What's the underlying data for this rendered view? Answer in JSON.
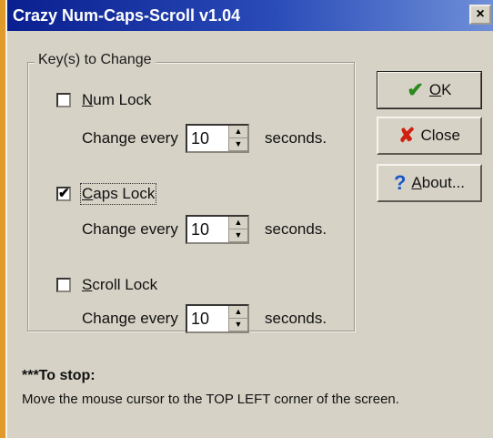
{
  "window": {
    "title": "Crazy Num-Caps-Scroll v1.04",
    "close_glyph": "×"
  },
  "group": {
    "legend": "Key(s) to Change",
    "keys": [
      {
        "key": "N",
        "rest": "um Lock",
        "checked": false,
        "change_label": "Change every",
        "value": "10",
        "unit": "seconds."
      },
      {
        "key": "C",
        "rest": "aps Lock",
        "checked": true,
        "change_label": "Change every",
        "value": "10",
        "unit": "seconds."
      },
      {
        "key": "S",
        "rest": "croll Lock",
        "checked": false,
        "change_label": "Change every",
        "value": "10",
        "unit": "seconds."
      }
    ]
  },
  "buttons": {
    "ok": {
      "icon": "checkmark-icon",
      "glyph": "✔",
      "key": "O",
      "rest": "K",
      "color": "#2a8a1c"
    },
    "close": {
      "icon": "x-icon",
      "glyph": "✘",
      "key": "",
      "rest": "Close",
      "color": "#d02010"
    },
    "about": {
      "icon": "question-icon",
      "glyph": "?",
      "key": "A",
      "rest": "bout...",
      "color": "#1a58c8"
    }
  },
  "stop": {
    "title": "***To stop:",
    "text": "Move the mouse cursor to the TOP LEFT corner of the screen."
  },
  "check_glyph": "✔",
  "spin_up": "▲",
  "spin_down": "▼"
}
